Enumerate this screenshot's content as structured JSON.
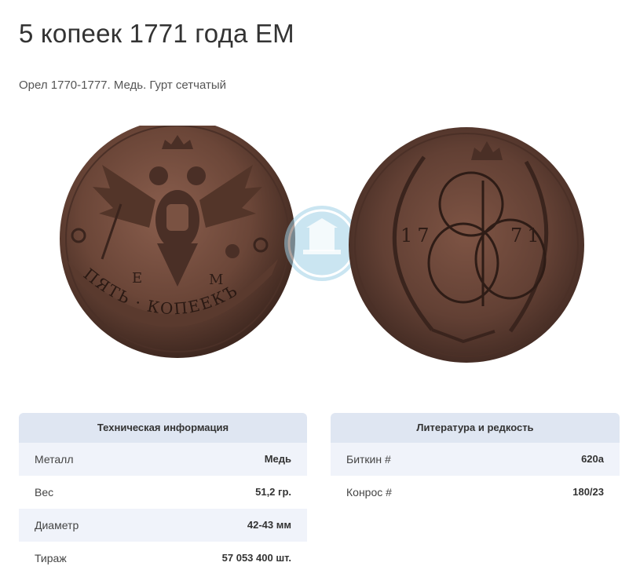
{
  "page": {
    "title": "5 копеек 1771 года ЕМ",
    "subtitle": "Орел 1770-1777. Медь. Гурт сетчатый"
  },
  "coin": {
    "obverse_legend": "ПЯТЬ · КОПЕЕКЪ",
    "mint_left": "Е",
    "mint_right": "М",
    "reverse_year_left": "17",
    "reverse_year_right": "71",
    "copper_color": "#6b4638",
    "watermark_color": "#4aa3c8"
  },
  "tech": {
    "heading": "Техническая информация",
    "rows": [
      {
        "label": "Металл",
        "value": "Медь"
      },
      {
        "label": "Вес",
        "value": "51,2 гр."
      },
      {
        "label": "Диаметр",
        "value": "42-43 мм"
      },
      {
        "label": "Тираж",
        "value": "57 053 400 шт."
      }
    ]
  },
  "lit": {
    "heading": "Литература и редкость",
    "rows": [
      {
        "label": "Биткин #",
        "value": "620а"
      },
      {
        "label": "Конрос #",
        "value": "180/23"
      }
    ]
  }
}
